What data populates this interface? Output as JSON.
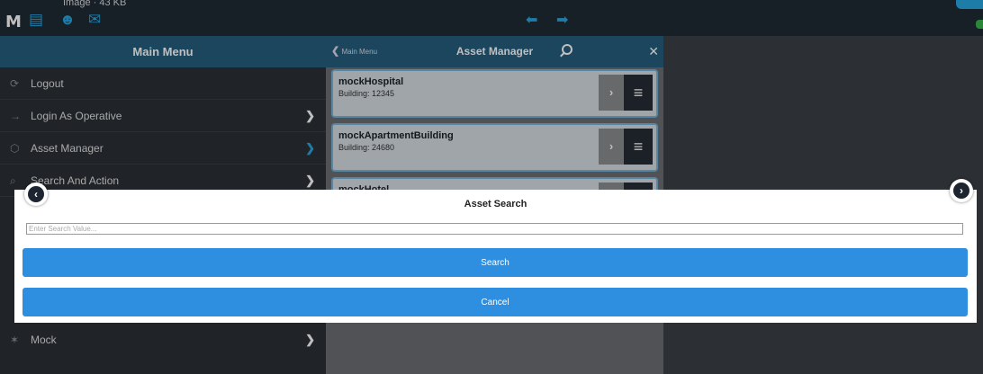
{
  "topbar": {
    "logo": "M",
    "caption": "Image · 43 KB",
    "icons": [
      "briefcase-icon",
      "user-icon",
      "envelope-icon"
    ]
  },
  "menu": {
    "title": "Main Menu",
    "items": [
      {
        "label": "Logout",
        "icon": "logout-icon"
      },
      {
        "label": "Login As Operative",
        "icon": "login-icon"
      },
      {
        "label": "Asset Manager",
        "icon": "asset-icon"
      },
      {
        "label": "Search And Action",
        "icon": "search-icon"
      }
    ],
    "bottom_item": {
      "label": "Mock",
      "icon": "bug-icon"
    }
  },
  "asset_manager": {
    "back_label": "Main Menu",
    "title": "Asset Manager",
    "cards": [
      {
        "name": "mockHospital",
        "building": "Building: 12345"
      },
      {
        "name": "mockApartmentBuilding",
        "building": "Building: 24680"
      },
      {
        "name": "mockHotel",
        "building": ""
      }
    ]
  },
  "dialog": {
    "title": "Asset Search",
    "placeholder": "Enter Search Value...",
    "search_label": "Search",
    "cancel_label": "Cancel"
  },
  "colors": {
    "accent": "#29a7e1",
    "header": "#255e7e",
    "button": "#2e8fe0"
  }
}
